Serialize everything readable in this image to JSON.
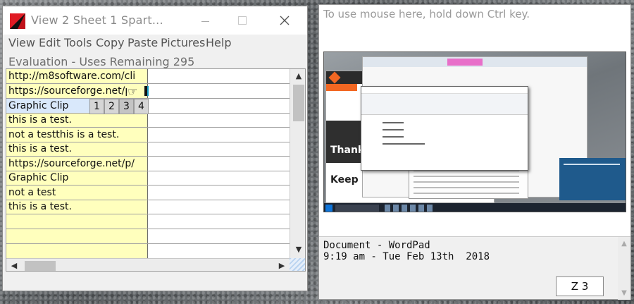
{
  "left_window": {
    "title": "View 2    Sheet 1    Spart...",
    "menu": [
      "View",
      "Edit",
      "Tools",
      "Copy",
      "Paste",
      "Pictures",
      "Help"
    ],
    "status": "Evaluation - Uses Remaining 295",
    "cells": [
      "http://m8software.com/cli",
      "https://sourceforge.net/p/",
      "Graphic Clip",
      "this is a test.",
      "not a testthis is a test.",
      "this is a test.",
      "https://sourceforge.net/p/",
      "Graphic Clip",
      "not a test",
      "this is a test."
    ],
    "clip_tabs": [
      "1",
      "2",
      "3",
      "4"
    ],
    "scroll": {
      "up": "▲",
      "down": "▼",
      "left": "◀",
      "right": "▶"
    },
    "close_glyph": "✕",
    "hand_glyph": "☞",
    "icon": "app-logo-icon"
  },
  "right_window": {
    "hint": "To use mouse here, hold down Ctrl key.",
    "preview_text": {
      "thank": "Thank",
      "keep": "Keep"
    },
    "doc_title": "Document - WordPad",
    "doc_time": "9:19 am - Tue Feb 13th  2018",
    "z_label": "Z 3",
    "scroll": {
      "up": "▲",
      "down": "▼"
    }
  },
  "colors": {
    "cell_yellow": "#ffffbd",
    "selected_cell": "#d9e8fb",
    "logo_red": "#e01b24"
  }
}
